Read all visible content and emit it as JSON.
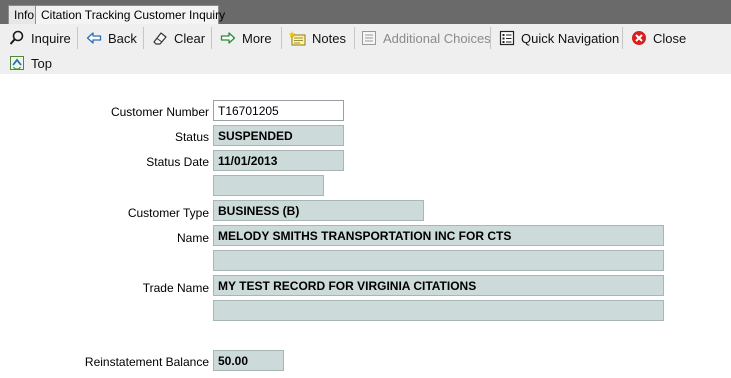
{
  "tabs": [
    {
      "label": "Info"
    },
    {
      "label": "Citation Tracking Customer Inquiry"
    }
  ],
  "toolbar": {
    "inquire": "Inquire",
    "back": "Back",
    "clear": "Clear",
    "more": "More",
    "notes": "Notes",
    "additional_choices": "Additional Choices",
    "quick_navigation": "Quick Navigation",
    "close": "Close",
    "top": "Top"
  },
  "form": {
    "customer_number_label": "Customer Number",
    "customer_number_value": "T16701205",
    "status_label": "Status",
    "status_value": "SUSPENDED",
    "status_date_label": "Status Date",
    "status_date_value": "11/01/2013",
    "status_extra_value": "",
    "customer_type_label": "Customer Type",
    "customer_type_value": "BUSINESS (B)",
    "name_label": "Name",
    "name_value": "MELODY SMITHS TRANSPORTATION INC FOR CTS",
    "name_line2_value": "",
    "trade_name_label": "Trade Name",
    "trade_name_value": "MY TEST RECORD FOR VIRGINIA CITATIONS",
    "trade_name_line2_value": "",
    "reinstatement_balance_label": "Reinstatement Balance",
    "reinstatement_balance_value": "50.00"
  }
}
